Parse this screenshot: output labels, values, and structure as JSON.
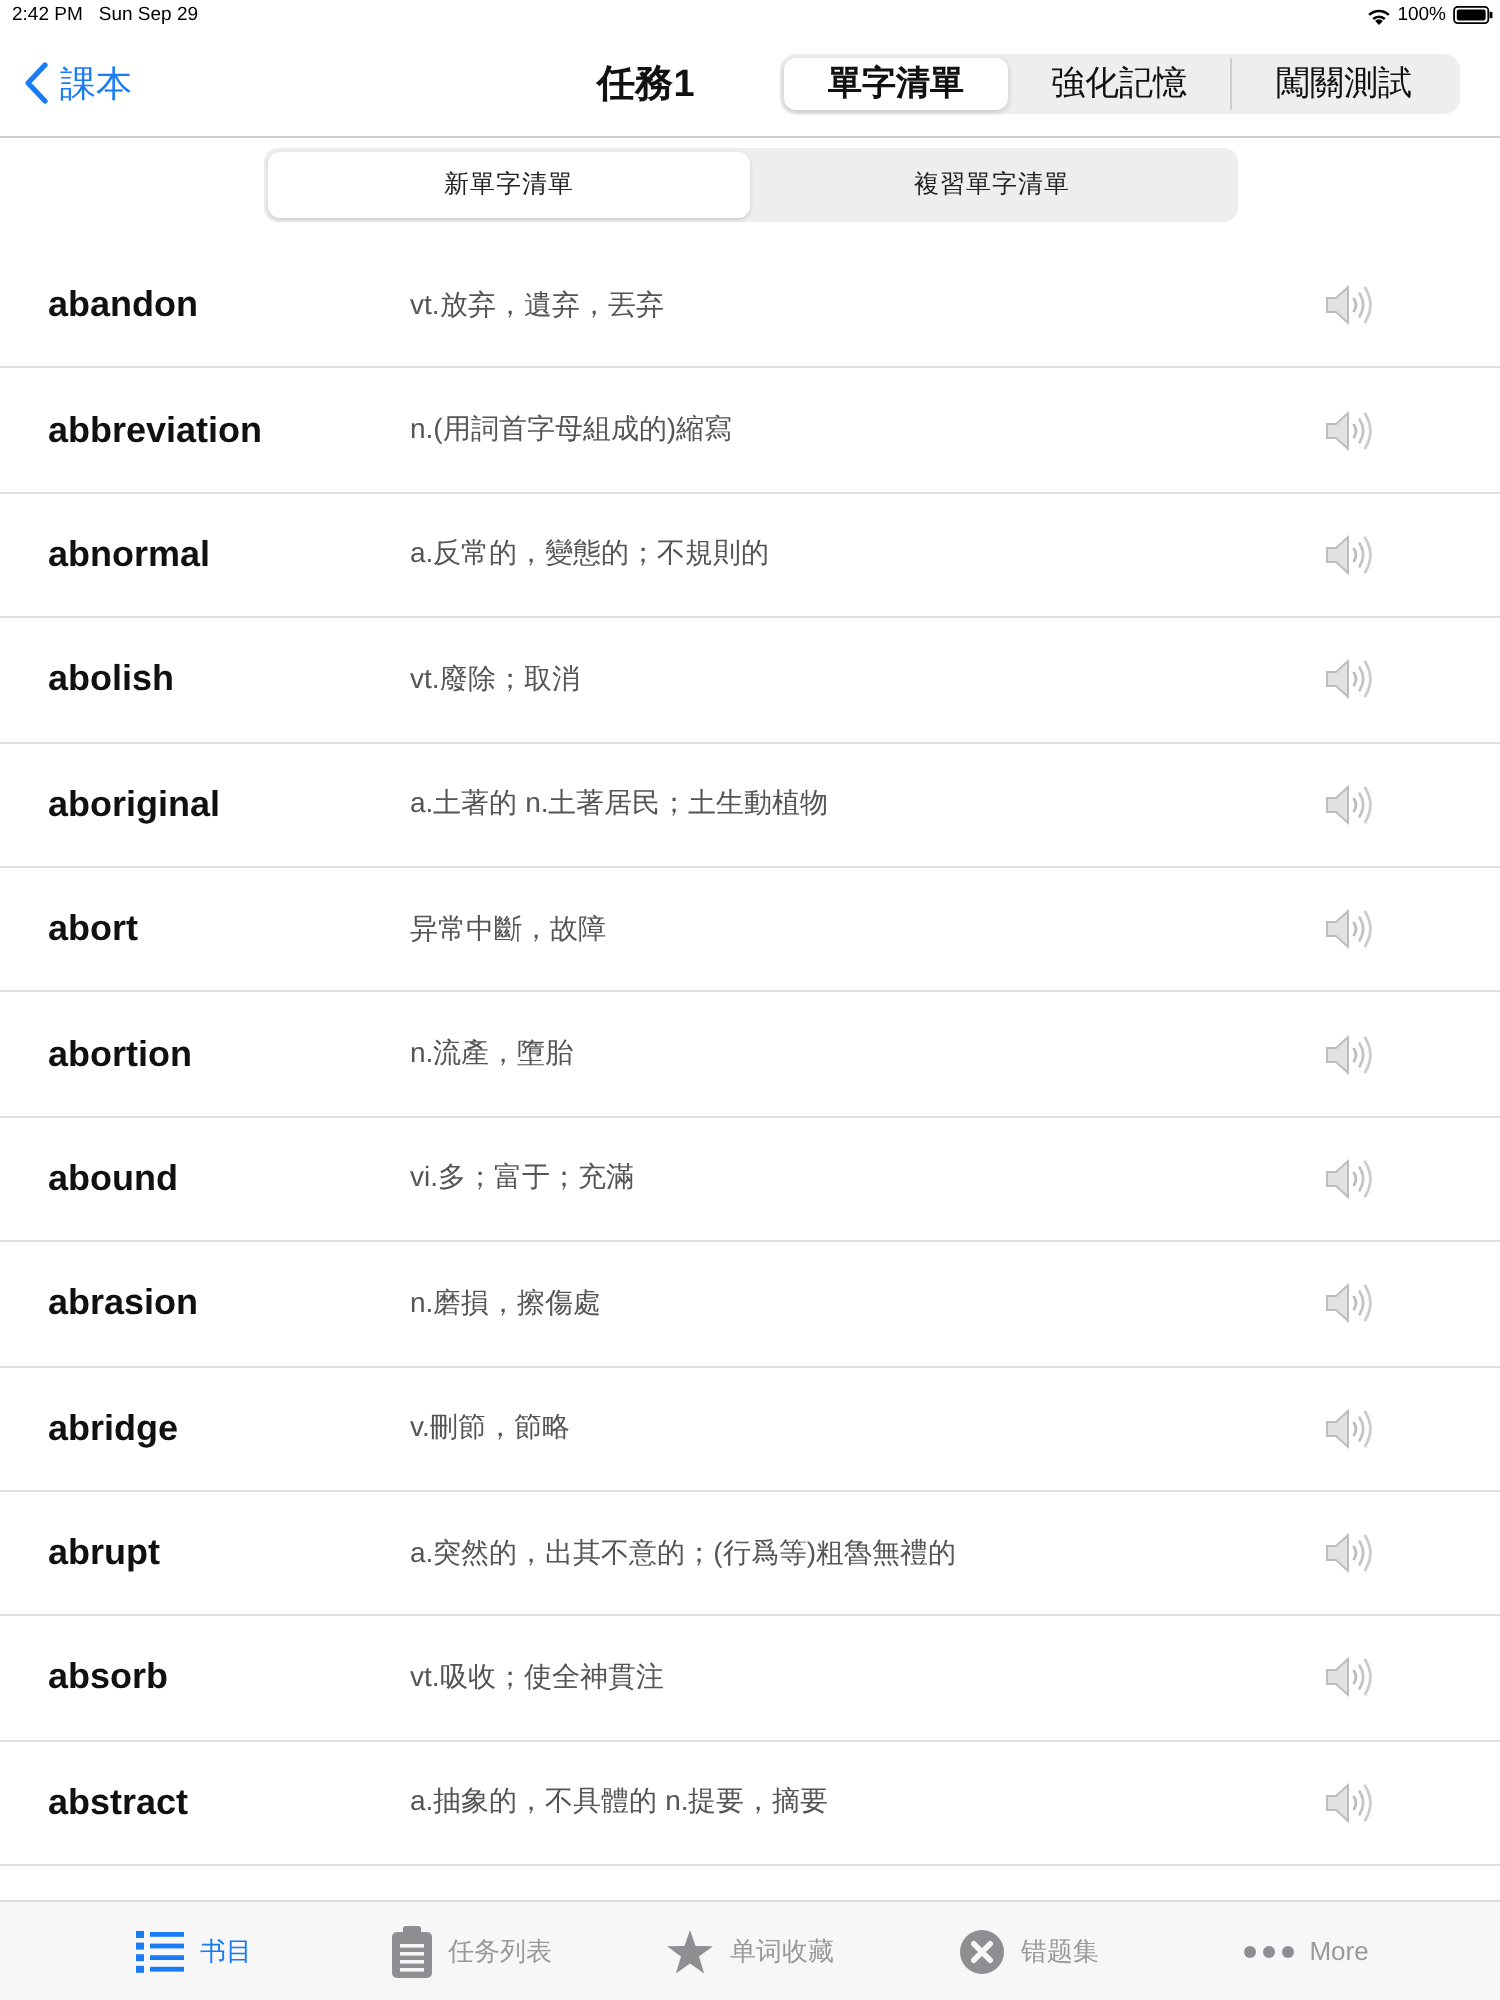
{
  "status_bar": {
    "time": "2:42 PM",
    "date": "Sun Sep 29",
    "battery": "100%"
  },
  "nav_bar": {
    "back": "課本",
    "title": "任務1",
    "segments": [
      {
        "label": "單字清單",
        "selected": true
      },
      {
        "label": "強化記憶",
        "selected": false
      },
      {
        "label": "闖關測試",
        "selected": false
      }
    ]
  },
  "list_switch": [
    {
      "label": "新單字清單",
      "selected": true
    },
    {
      "label": "複習單字清單",
      "selected": false
    }
  ],
  "words": [
    {
      "word": "abandon",
      "definition": "vt.放弃，遺弃，丟弃"
    },
    {
      "word": "abbreviation",
      "definition": "n.(用詞首字母組成的)縮寫"
    },
    {
      "word": "abnormal",
      "definition": "a.反常的，變態的；不規則的"
    },
    {
      "word": "abolish",
      "definition": "vt.廢除；取消"
    },
    {
      "word": "aboriginal",
      "definition": "a.土著的 n.土著居民；土生動植物"
    },
    {
      "word": "abort",
      "definition": "异常中斷，故障"
    },
    {
      "word": "abortion",
      "definition": "n.流產，墮胎"
    },
    {
      "word": "abound",
      "definition": "vi.多；富于；充滿"
    },
    {
      "word": "abrasion",
      "definition": "n.磨損，擦傷處"
    },
    {
      "word": "abridge",
      "definition": "v.刪節，節略"
    },
    {
      "word": "abrupt",
      "definition": "a.突然的，出其不意的；(行爲等)粗魯無禮的"
    },
    {
      "word": "absorb",
      "definition": "vt.吸收；使全神貫注"
    },
    {
      "word": "abstract",
      "definition": "a.抽象的，不具體的 n.提要，摘要"
    }
  ],
  "tab_bar": [
    {
      "label": "书目",
      "selected": true
    },
    {
      "label": "任务列表",
      "selected": false
    },
    {
      "label": "单词收藏",
      "selected": false
    },
    {
      "label": "错题集",
      "selected": false
    },
    {
      "label": "More",
      "selected": false
    }
  ]
}
